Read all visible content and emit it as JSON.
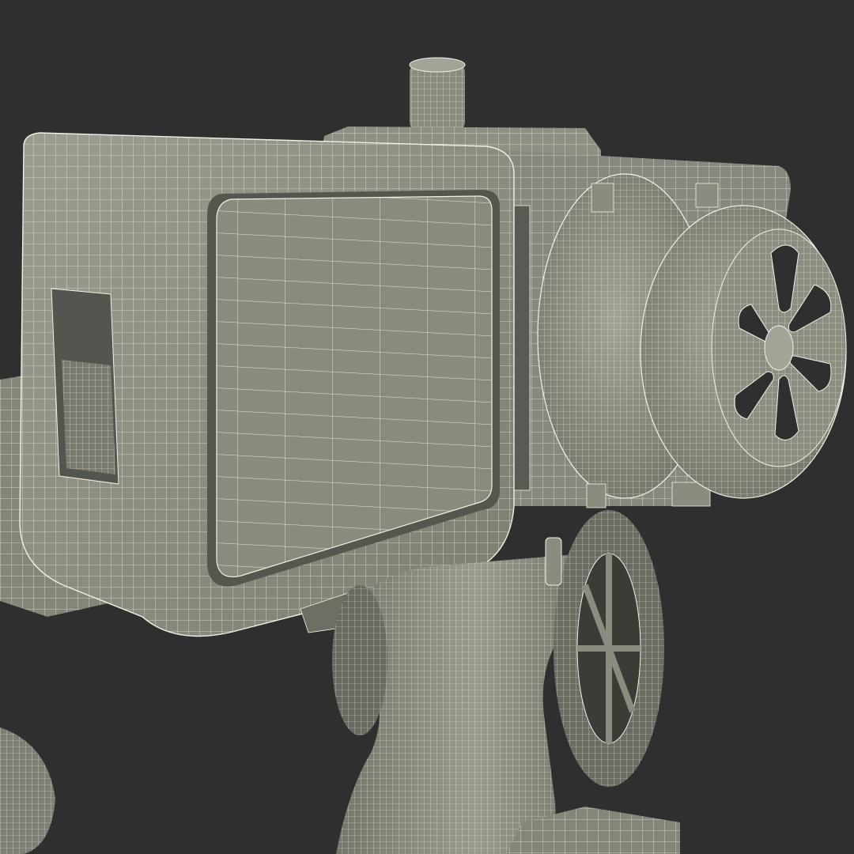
{
  "scene": {
    "subject": "rc-transmitter-wireframe-render",
    "colors": {
      "background": "#2f2f2f",
      "surface": "#8e8e82",
      "surface_light": "#a3a397",
      "surface_dark": "#6c6c63",
      "shadow": "#3b3b38",
      "wire": "#f2f1e6"
    }
  }
}
